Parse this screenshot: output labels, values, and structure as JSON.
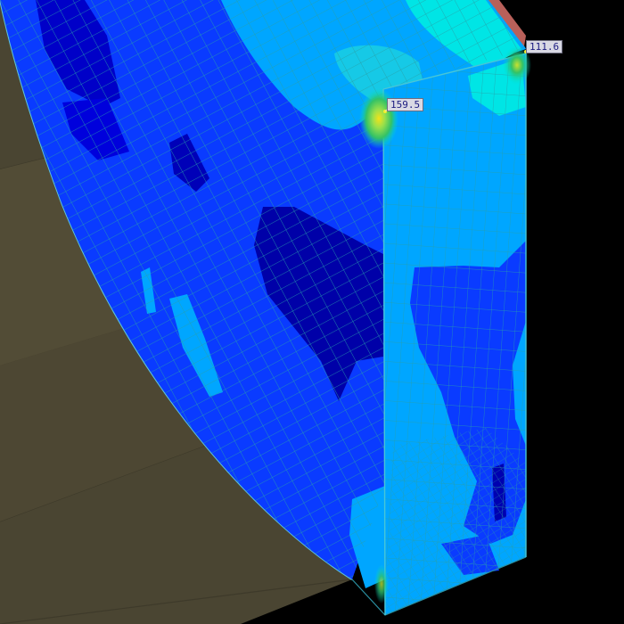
{
  "probes": [
    {
      "id": "probe-1",
      "value": "159.5"
    },
    {
      "id": "probe-2",
      "value": "111.6"
    }
  ],
  "colors": {
    "background": "#000000",
    "ground": "#4a4532",
    "contour_darkest": "#0000a8",
    "contour_dark": "#0000e6",
    "contour_mid": "#0a3bff",
    "contour_light": "#00a6ff",
    "contour_cyan": "#00e5e5",
    "contour_green": "#33c266",
    "contour_yellow": "#d9e020",
    "mesh_line": "#27a0a8",
    "probe_text": "#1a1a80",
    "probe_bg": "#d9d9e4"
  }
}
